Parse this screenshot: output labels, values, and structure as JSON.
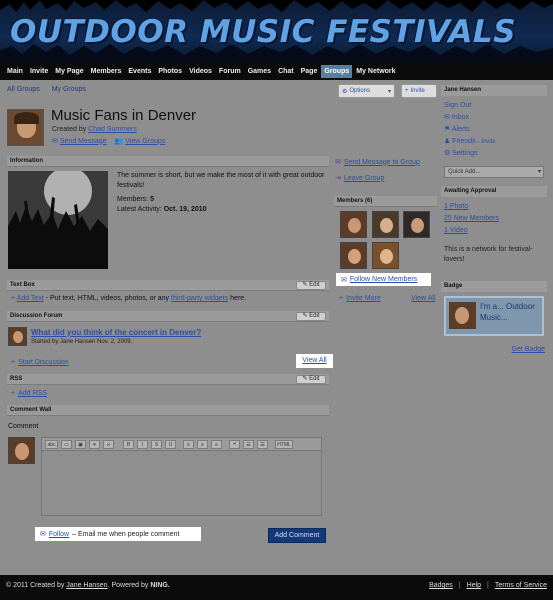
{
  "banner": {
    "title": "OUTDOOR MUSIC FESTIVALS"
  },
  "nav": {
    "items": [
      "Main",
      "Invite",
      "My Page",
      "Members",
      "Events",
      "Photos",
      "Videos",
      "Forum",
      "Games",
      "Chat",
      "Page",
      "Groups",
      "My Network"
    ],
    "active": "Groups"
  },
  "subnav": {
    "all_groups": "All Groups",
    "my_groups": "My Groups"
  },
  "top_buttons": {
    "options": "Options",
    "invite": "Invite"
  },
  "group": {
    "title": "Music Fans in Denver",
    "created_prefix": "Created by",
    "creator": "Chad Summers",
    "send_message": "Send Message",
    "view_groups": "View Groups"
  },
  "information": {
    "heading": "Information",
    "description": "The summer is short, but we make the most of it with great outdoor festivals!",
    "members_label": "Members:",
    "members_count": "5",
    "activity_label": "Latest Activity:",
    "activity_date": "Oct. 19, 2010"
  },
  "group_side": {
    "send_message_group": "Send Message to Group",
    "leave_group": "Leave Group",
    "members_heading": "Members (6)",
    "follow_new_members": "Follow New Members",
    "invite_more": "Invite More",
    "view_all": "View All"
  },
  "textbox": {
    "heading": "Text Box",
    "edit": "Edit",
    "add_text": "Add Text",
    "hint_pre": " - Put text, HTML, videos, photos, or any ",
    "hint_link": "third-party widgets",
    "hint_post": " here."
  },
  "forum": {
    "heading": "Discussion Forum",
    "edit": "Edit",
    "topic_title": "What did you think of the concert in Denver?",
    "topic_meta": "Started by Jane Hansen Nov. 2, 2009.",
    "start_discussion": "Start Discussion",
    "view_all": "View All"
  },
  "rss": {
    "heading": "RSS",
    "edit": "Edit",
    "add_rss": "Add RSS"
  },
  "comment_wall": {
    "heading": "Comment Wall",
    "comment_label": "Comment",
    "toolbar": [
      "abc",
      "▭",
      "▣",
      "▾",
      "∞",
      "B",
      "I",
      "S",
      "U",
      "≡",
      "≡",
      "≡",
      "❝",
      "☰",
      "☰",
      "HTML"
    ],
    "follow": "Follow",
    "follow_text": " – Email me when people comment",
    "add_comment": "Add Comment"
  },
  "user_panel": {
    "name": "Jane Hansen",
    "sign_out": "Sign Out",
    "inbox": "Inbox",
    "alerts": "Alerts",
    "friends": "Friends",
    "friends_invite": "- Invite",
    "settings": "Settings",
    "quick_add": "Quick Add..."
  },
  "approval": {
    "heading": "Awaiting Approval",
    "items": [
      "1 Photo",
      "25 New Members",
      "1 Video"
    ],
    "note": "This is a network for festival-lovers!"
  },
  "badge": {
    "heading": "Badge",
    "text": "I'm a... Outdoor Music...",
    "get_badge": "Get Badge"
  },
  "footer": {
    "copyright": "© 2011   Created by",
    "creator": "Jane Hansen",
    "powered": ".   Powered by",
    "ning": "NING.",
    "links": [
      "Badges",
      "Help",
      "Terms of Service"
    ]
  }
}
